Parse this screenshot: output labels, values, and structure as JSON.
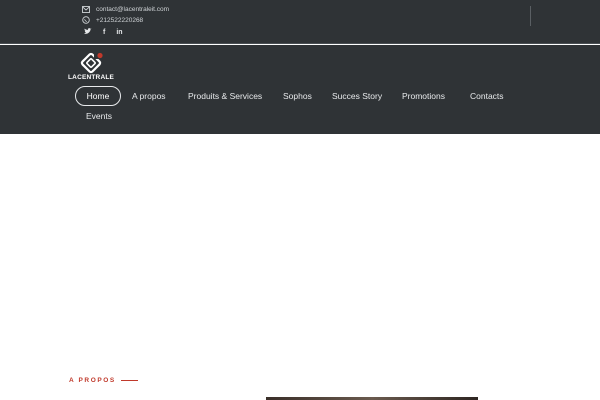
{
  "topbar": {
    "email": "contact@lacentraleit.com",
    "phone": "+212522220268",
    "social": [
      {
        "name": "twitter",
        "glyph": "🐦"
      },
      {
        "name": "facebook",
        "glyph": "f"
      },
      {
        "name": "linkedin",
        "glyph": "in"
      }
    ]
  },
  "brand": {
    "name": "LACENTRALE",
    "accent": "#c0392b"
  },
  "nav": {
    "home": "Home",
    "items": [
      "A propos",
      "Produits & Services",
      "Sophos",
      "Succes Story",
      "Promotions",
      "Contacts",
      "Events"
    ]
  },
  "section": {
    "label": "A PROPOS"
  }
}
